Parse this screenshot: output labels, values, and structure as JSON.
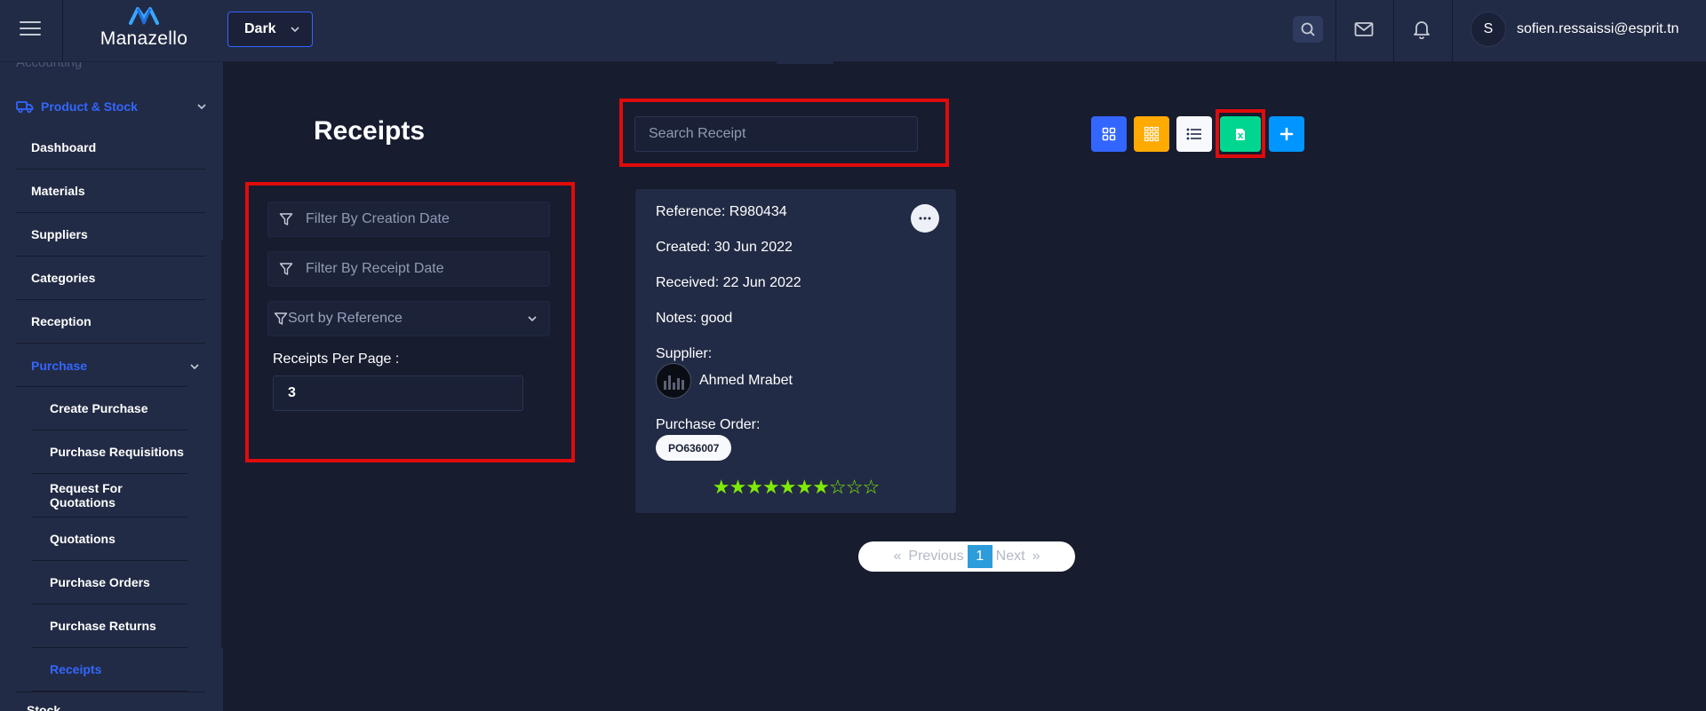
{
  "header": {
    "app_name": "Manazello",
    "theme_value": "Dark",
    "user_initial": "S",
    "user_email": "sofien.ressaissi@esprit.tn"
  },
  "sidebar": {
    "partial_top_label": "Accounting",
    "section_label": "Product & Stock",
    "items": [
      "Dashboard",
      "Materials",
      "Suppliers",
      "Categories",
      "Reception"
    ],
    "purchase_label": "Purchase",
    "purchase_sub_items": [
      "Create Purchase",
      "Purchase Requisitions",
      "Request For Quotations",
      "Quotations",
      "Purchase Orders",
      "Purchase Returns",
      "Receipts"
    ],
    "partial_bottom_label": "Stock"
  },
  "main": {
    "title": "Receipts",
    "search_placeholder": "Search Receipt",
    "filters": {
      "creation_date_placeholder": "Filter By Creation Date",
      "receipt_date_placeholder": "Filter By Receipt Date",
      "sort_label": "Sort by Reference",
      "per_page_label": "Receipts Per Page :",
      "per_page_value": "3"
    },
    "toolbar_icons": [
      "grid-view-icon",
      "tiles-view-icon",
      "list-view-icon",
      "excel-export-icon",
      "add-icon"
    ]
  },
  "receipt_card": {
    "reference": "Reference: R980434",
    "created": "Created: 30 Jun 2022",
    "received": "Received: 22 Jun 2022",
    "notes": "Notes: good",
    "supplier_label": "Supplier:",
    "supplier_name": "Ahmed Mrabet",
    "po_label": "Purchase Order:",
    "po_number": "PO636007",
    "rating": 7,
    "rating_max": 10
  },
  "pagination": {
    "first": "«",
    "previous": "Previous",
    "current": "1",
    "next": "Next",
    "last": "»"
  },
  "colors": {
    "background": "#171c2f",
    "panel": "#222b45",
    "accent": "#3366ff",
    "highlight_box": "#e00b0b",
    "star": "#7eea07",
    "btn_grid": "#3366ff",
    "btn_tiles": "#ffaa00",
    "btn_list": "#f7f9fc",
    "btn_excel": "#00d68f",
    "btn_add": "#0095ff"
  }
}
